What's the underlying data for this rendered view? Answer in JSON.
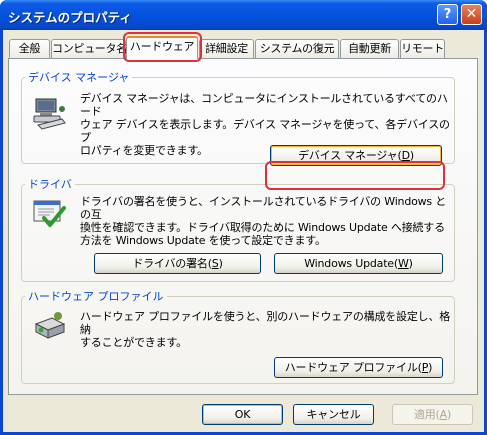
{
  "window": {
    "title": "システムのプロパティ",
    "help_glyph": "?",
    "close_glyph": "✕"
  },
  "tabs": [
    {
      "label": "全般",
      "active": false
    },
    {
      "label": "コンピュータ名",
      "active": false
    },
    {
      "label": "ハードウェア",
      "active": true
    },
    {
      "label": "詳細設定",
      "active": false
    },
    {
      "label": "システムの復元",
      "active": false
    },
    {
      "label": "自動更新",
      "active": false
    },
    {
      "label": "リモート",
      "active": false
    }
  ],
  "device_manager": {
    "title": "デバイス マネージャ",
    "description_lines": [
      "デバイス マネージャは、コンピュータにインストールされているすべてのハード",
      "ウェア デバイスを表示します。デバイス マネージャを使って、各デバイスのプ",
      "ロパティを変更できます。"
    ],
    "button_label": "デバイス マネージャ(",
    "button_key": "D",
    "button_suffix": ")",
    "icon": "device-manager-icon"
  },
  "drivers": {
    "title": "ドライバ",
    "description_lines": [
      "ドライバの署名を使うと、インストールされているドライバの Windows との互",
      "換性を確認できます。ドライバ取得のために Windows Update へ接続する",
      "方法を Windows Update を使って設定できます。"
    ],
    "signing_label": "ドライバの署名(",
    "signing_key": "S",
    "signing_suffix": ")",
    "update_label": "Windows Update(",
    "update_key": "W",
    "update_suffix": ")",
    "icon": "driver-checkmark-icon"
  },
  "hardware_profiles": {
    "title": "ハードウェア プロファイル",
    "description_lines": [
      "ハードウェア プロファイルを使うと、別のハードウェアの構成を設定し、格納",
      "することができます。"
    ],
    "button_label": "ハードウェア プロファイル(",
    "button_key": "P",
    "button_suffix": ")",
    "icon": "hardware-profile-icon"
  },
  "footer": {
    "ok_label": "OK",
    "cancel_label": "キャンセル",
    "apply_label": "適用(",
    "apply_key": "A",
    "apply_suffix": ")"
  },
  "colors": {
    "title_bar": "#0553dd",
    "dialog_face": "#ece9d8",
    "group_title": "#0046d5",
    "annotation_ring": "#e0303c",
    "active_tab_accent": "#e68b2c"
  }
}
